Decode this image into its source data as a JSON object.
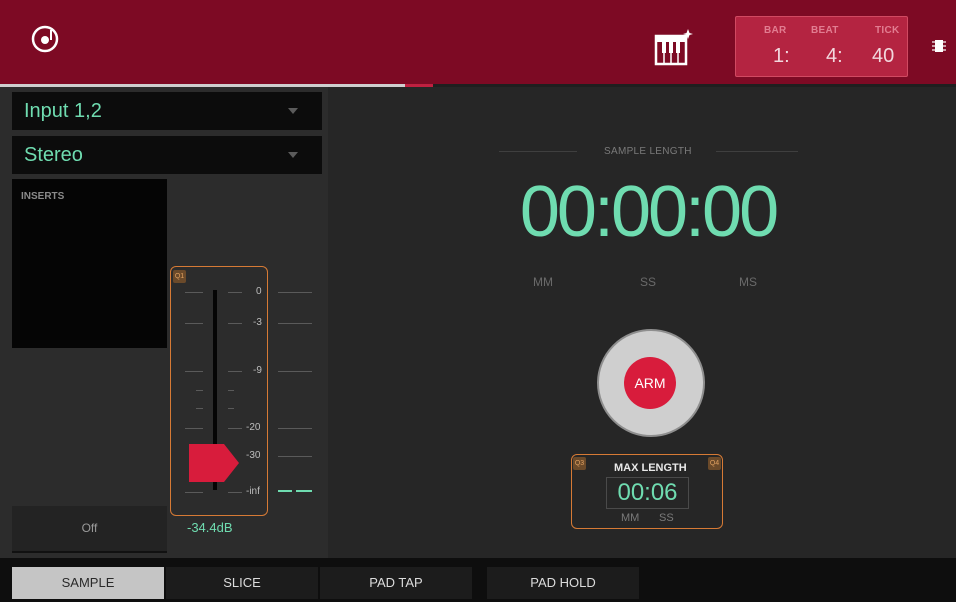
{
  "topbar": {
    "counter": {
      "bar_label": "BAR",
      "beat_label": "BEAT",
      "tick_label": "TICK",
      "bar_value": "1:",
      "beat_value": "4:",
      "tick_value": "40"
    },
    "icons": [
      "turntable-icon",
      "keyboard-sparkle-icon",
      "chip-icon"
    ]
  },
  "left": {
    "input_source": "Input 1,2",
    "channel_mode": "Stereo",
    "inserts_label": "INSERTS",
    "off_label": "Off",
    "fader": {
      "q_tag": "Q1",
      "scale": [
        "0",
        "-3",
        "-9",
        "-20",
        "-30",
        "-inf"
      ],
      "gain_value": "-34.4dB"
    }
  },
  "main": {
    "sample_length_label": "SAMPLE LENGTH",
    "time_display": "00:00:00",
    "units": [
      "MM",
      "SS",
      "MS"
    ],
    "arm_label": "ARM",
    "max_length": {
      "q_left": "Q3",
      "q_right": "Q4",
      "label": "MAX LENGTH",
      "value": "00:06",
      "units": [
        "MM",
        "SS"
      ]
    }
  },
  "tabs": [
    {
      "label": "SAMPLE",
      "active": true
    },
    {
      "label": "SLICE",
      "active": false
    },
    {
      "label": "PAD TAP",
      "active": false
    },
    {
      "label": "PAD HOLD",
      "active": false
    }
  ],
  "colors": {
    "brand_red": "#7d0a24",
    "accent_green": "#6fdcb0",
    "arm_red": "#d81c3c",
    "q_orange": "#d67a35"
  }
}
